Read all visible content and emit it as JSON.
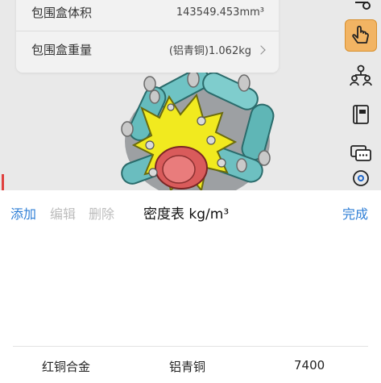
{
  "properties": {
    "rows": [
      {
        "label": "包围盒体积",
        "value": "143549.453mm³"
      },
      {
        "label": "包围盒重量",
        "value": "(铝青铜)1.062kg"
      }
    ]
  },
  "toolbar": {
    "items": [
      {
        "icon": "measure-icon"
      },
      {
        "icon": "hand-pointer-icon",
        "active": true
      },
      {
        "icon": "hierarchy-icon"
      },
      {
        "icon": "book-icon"
      },
      {
        "icon": "chat-icon"
      },
      {
        "icon": "settings-icon"
      }
    ],
    "active_color": "#f2b463"
  },
  "sheet": {
    "add_label": "添加",
    "edit_label": "编辑",
    "delete_label": "删除",
    "title": "密度表 kg/m³",
    "done_label": "完成",
    "accent_color": "#2f7fd6",
    "rows": [
      {
        "name": "红铜合金",
        "material": "铝青铜",
        "density": "7400"
      }
    ]
  }
}
